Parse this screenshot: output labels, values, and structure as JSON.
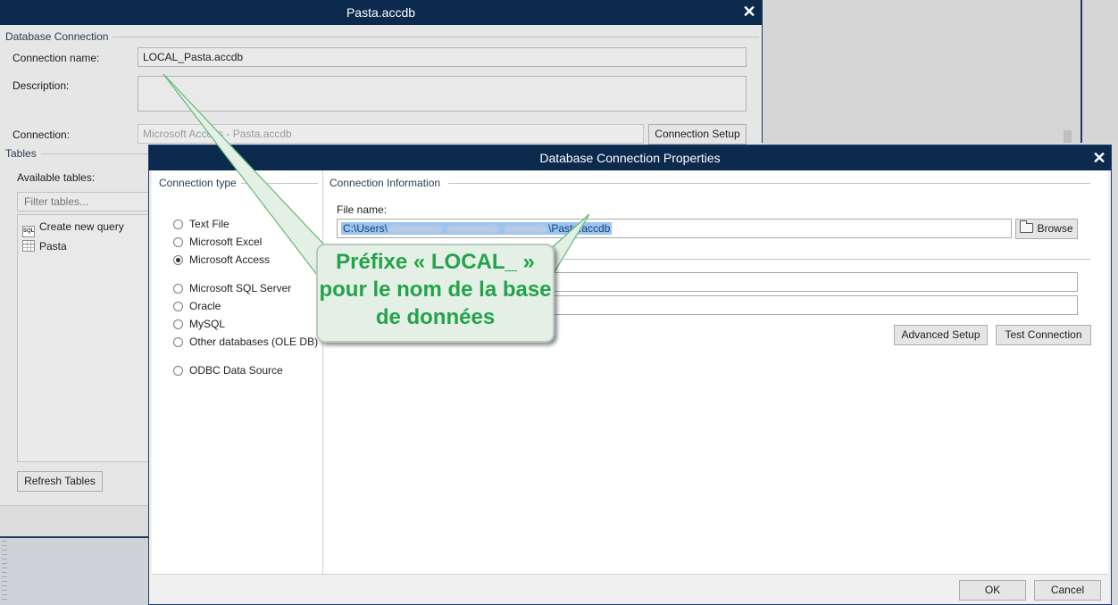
{
  "background_window": {
    "title": "Pasta.accdb",
    "close_glyph": "✕",
    "group_database_connection": "Database Connection",
    "connection_name_label": "Connection name:",
    "connection_name_value": "LOCAL_Pasta.accdb",
    "description_label": "Description:",
    "description_value": "",
    "connection_label": "Connection:",
    "connection_value": "Microsoft Access - Pasta.accdb",
    "connection_setup_button": "Connection Setup",
    "group_tables": "Tables",
    "available_tables_label": "Available tables:",
    "filter_placeholder": "Filter tables...",
    "tables": [
      {
        "icon": "sql-query-icon",
        "label": "Create new query"
      },
      {
        "icon": "table-icon",
        "label": "Pasta"
      }
    ],
    "refresh_tables_button": "Refresh Tables"
  },
  "dialog": {
    "title": "Database Connection Properties",
    "close_glyph": "✕",
    "connection_type_header": "Connection type",
    "connection_types": [
      {
        "label": "Text File",
        "selected": false
      },
      {
        "label": "Microsoft Excel",
        "selected": false
      },
      {
        "label": "Microsoft Access",
        "selected": true
      },
      {
        "label": "Microsoft SQL Server",
        "selected": false
      },
      {
        "label": "Oracle",
        "selected": false
      },
      {
        "label": "MySQL",
        "selected": false
      },
      {
        "label": "Other databases (OLE DB)",
        "selected": false
      },
      {
        "label": "ODBC Data Source",
        "selected": false
      }
    ],
    "connection_info_header": "Connection Information",
    "file_name_label": "File name:",
    "file_path_prefix": "C:\\Users\\",
    "file_path_suffix": "\\Pasta.accdb",
    "browse_button": "Browse",
    "advanced_setup_button": "Advanced Setup",
    "test_connection_button": "Test Connection",
    "ok_button": "OK",
    "cancel_button": "Cancel"
  },
  "callout": {
    "lines": [
      "Préfixe « LOCAL_ »",
      "pour le nom de la base",
      "de données"
    ]
  },
  "colors": {
    "titlebar": "#0b2a4e",
    "callout_text": "#23a34a",
    "callout_bg": "#e4efe6",
    "selection": "#99c4ee"
  }
}
